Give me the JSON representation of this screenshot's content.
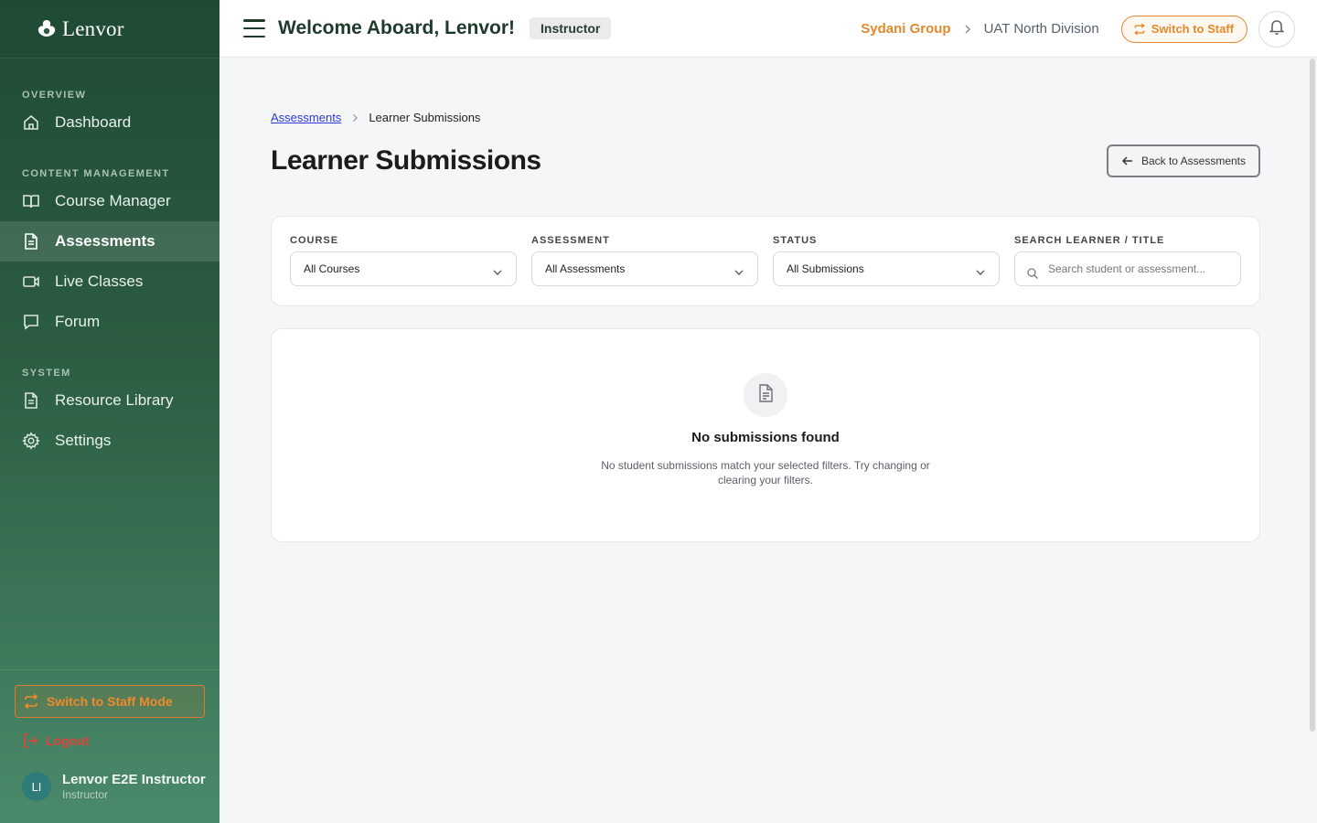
{
  "brand": {
    "name": "Lenvor"
  },
  "sidebar": {
    "sections": [
      {
        "label": "OVERVIEW"
      },
      {
        "label": "CONTENT MANAGEMENT"
      },
      {
        "label": "SYSTEM"
      }
    ],
    "items": [
      {
        "label": "Dashboard",
        "icon": "home-icon"
      },
      {
        "label": "Course Manager",
        "icon": "book-icon"
      },
      {
        "label": "Assessments",
        "icon": "document-icon",
        "active": true
      },
      {
        "label": "Live Classes",
        "icon": "video-icon"
      },
      {
        "label": "Forum",
        "icon": "chat-icon"
      },
      {
        "label": "Resource Library",
        "icon": "document-icon"
      },
      {
        "label": "Settings",
        "icon": "gear-icon"
      }
    ],
    "switch_mode_label": "Switch to Staff Mode",
    "logout_label": "Logout",
    "user": {
      "initials": "LI",
      "name": "Lenvor E2E Instructor",
      "role": "Instructor"
    }
  },
  "header": {
    "welcome": "Welcome Aboard, Lenvor!",
    "role_badge": "Instructor",
    "org_group": "Sydani Group",
    "org_division": "UAT North Division",
    "switch_label": "Switch to Staff"
  },
  "breadcrumb": {
    "parent": "Assessments",
    "current": "Learner Submissions"
  },
  "page": {
    "title": "Learner Submissions",
    "back_label": "Back to Assessments"
  },
  "filters": {
    "course": {
      "label": "COURSE",
      "value": "All Courses"
    },
    "assessment": {
      "label": "ASSESSMENT",
      "value": "All Assessments"
    },
    "status": {
      "label": "STATUS",
      "value": "All Submissions"
    },
    "search": {
      "label": "SEARCH LEARNER / TITLE",
      "placeholder": "Search student or assessment..."
    }
  },
  "empty_state": {
    "title": "No submissions found",
    "description": "No student submissions match your selected filters. Try changing or clearing your filters."
  },
  "colors": {
    "sidebar_dark": "#1f4a34",
    "accent_orange": "#e58a2c",
    "logout_red": "#e0443a",
    "link_blue": "#2a3bd8"
  }
}
